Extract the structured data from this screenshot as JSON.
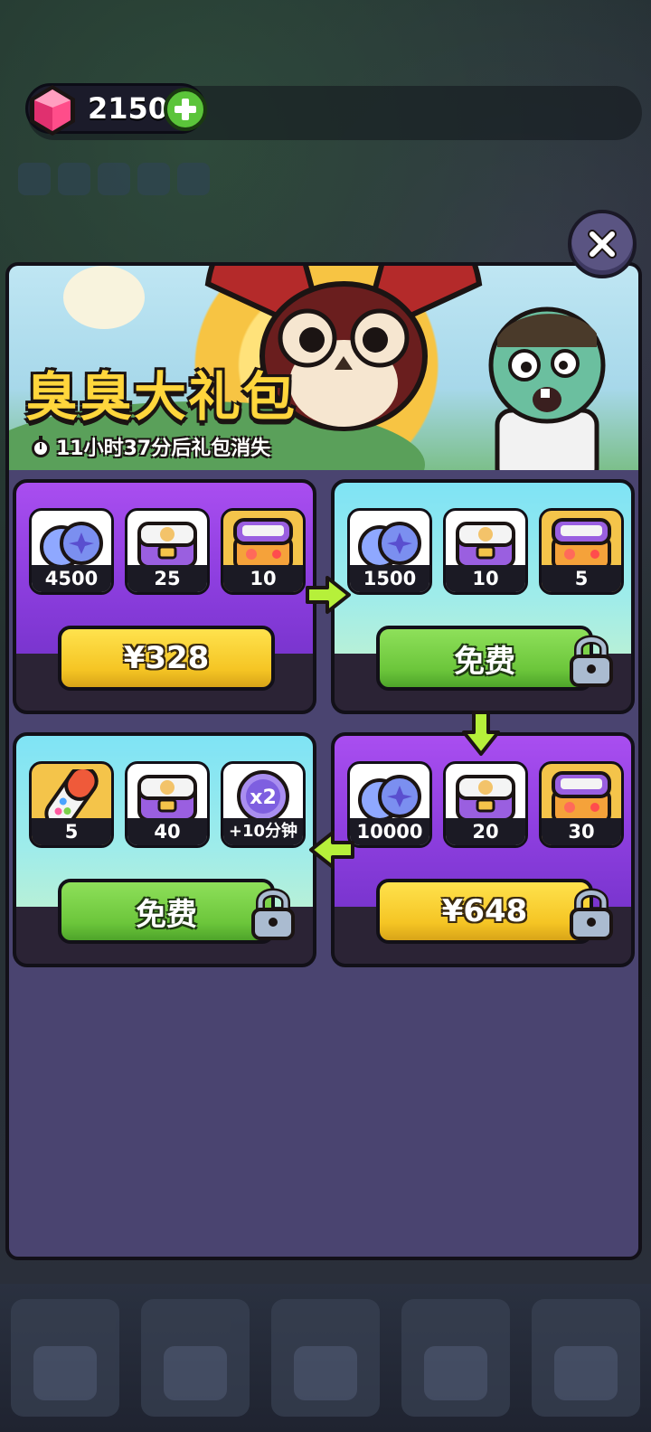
{
  "currency": {
    "amount": "2150",
    "icon": "gem-icon",
    "add_icon": "plus-icon"
  },
  "banner": {
    "title": "臭臭大礼包",
    "timer": "11小时37分后礼包消失"
  },
  "colors": {
    "title_yellow": "#ffd63c",
    "price_yellow": "#f5c524",
    "free_green": "#6cc63b",
    "purple_card": "#8f3fe0",
    "cyan_card": "#9fecea",
    "modal_bg": "#4a4470"
  },
  "packs": [
    {
      "id": "pack1",
      "theme": "purple",
      "locked": false,
      "button": "¥328",
      "items": [
        {
          "icon": "blue-orbs-icon",
          "qty": "4500"
        },
        {
          "icon": "white-chest-icon",
          "qty": "25"
        },
        {
          "icon": "gold-chest-icon",
          "qty": "10"
        }
      ]
    },
    {
      "id": "pack2",
      "theme": "cyan",
      "locked": true,
      "button": "免费",
      "items": [
        {
          "icon": "blue-orbs-icon",
          "qty": "1500"
        },
        {
          "icon": "white-chest-icon",
          "qty": "10"
        },
        {
          "icon": "gold-chest-icon",
          "qty": "5"
        }
      ]
    },
    {
      "id": "pack3",
      "theme": "purple",
      "locked": true,
      "button": "¥648",
      "items": [
        {
          "icon": "blue-orbs-icon",
          "qty": "10000"
        },
        {
          "icon": "white-chest-icon",
          "qty": "20"
        },
        {
          "icon": "gold-chest-icon",
          "qty": "30"
        }
      ]
    },
    {
      "id": "pack4",
      "theme": "cyan",
      "locked": true,
      "button": "免费",
      "items": [
        {
          "icon": "capsule-icon",
          "qty": "5"
        },
        {
          "icon": "white-chest-icon",
          "qty": "40"
        },
        {
          "icon": "x2-boost-icon",
          "qty": "+10分钟",
          "badge": "x2"
        }
      ]
    }
  ]
}
